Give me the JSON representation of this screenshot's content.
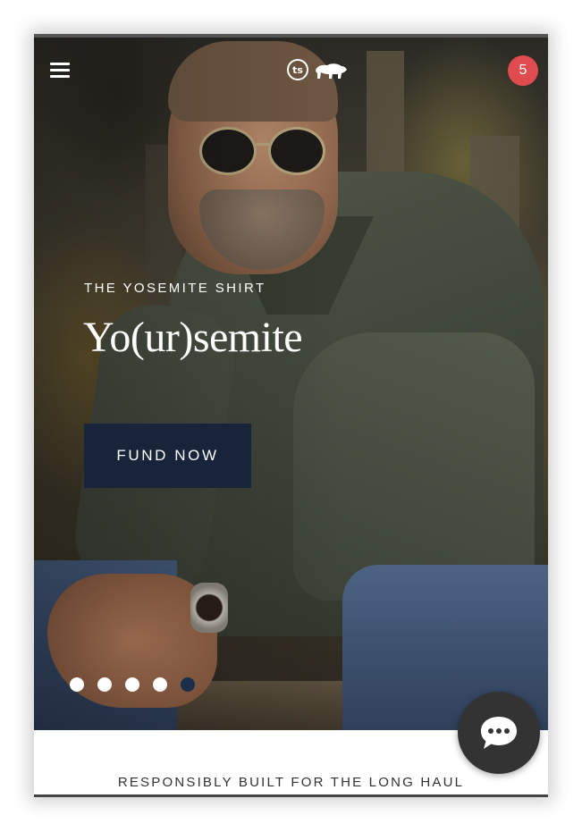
{
  "header": {
    "menu_icon": "hamburger-menu-icon",
    "logo_text": "ts",
    "logo_icon": "bear-icon",
    "cart_count": "5",
    "cart_badge_color": "#e04b4f"
  },
  "hero": {
    "kicker": "THE YOSEMITE SHIRT",
    "headline": "Yo(ur)semite",
    "cta_label": "FUND NOW",
    "cta_color": "#18243a",
    "carousel": {
      "total": 5,
      "active_index": 4
    }
  },
  "section": {
    "tagline": "RESPONSIBLY BUILT FOR THE LONG HAUL"
  },
  "chat": {
    "icon": "chat-bubble-icon"
  }
}
